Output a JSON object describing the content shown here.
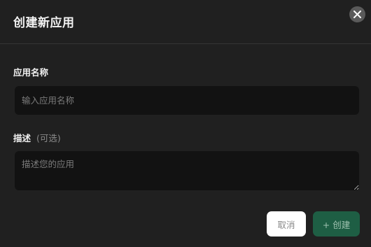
{
  "dialog": {
    "title": "创建新应用",
    "close_icon": "close-icon"
  },
  "form": {
    "name_label": "应用名称",
    "name_placeholder": "输入应用名称",
    "name_value": "",
    "description_label": "描述",
    "description_optional": "(可选)",
    "description_placeholder": "描述您的应用",
    "description_value": ""
  },
  "actions": {
    "cancel_label": "取消",
    "create_label": "+ 创建"
  },
  "colors": {
    "background": "#202020",
    "input_background": "#121212",
    "primary_button": "#1e5e44",
    "close_button": "#5a5a5a"
  }
}
